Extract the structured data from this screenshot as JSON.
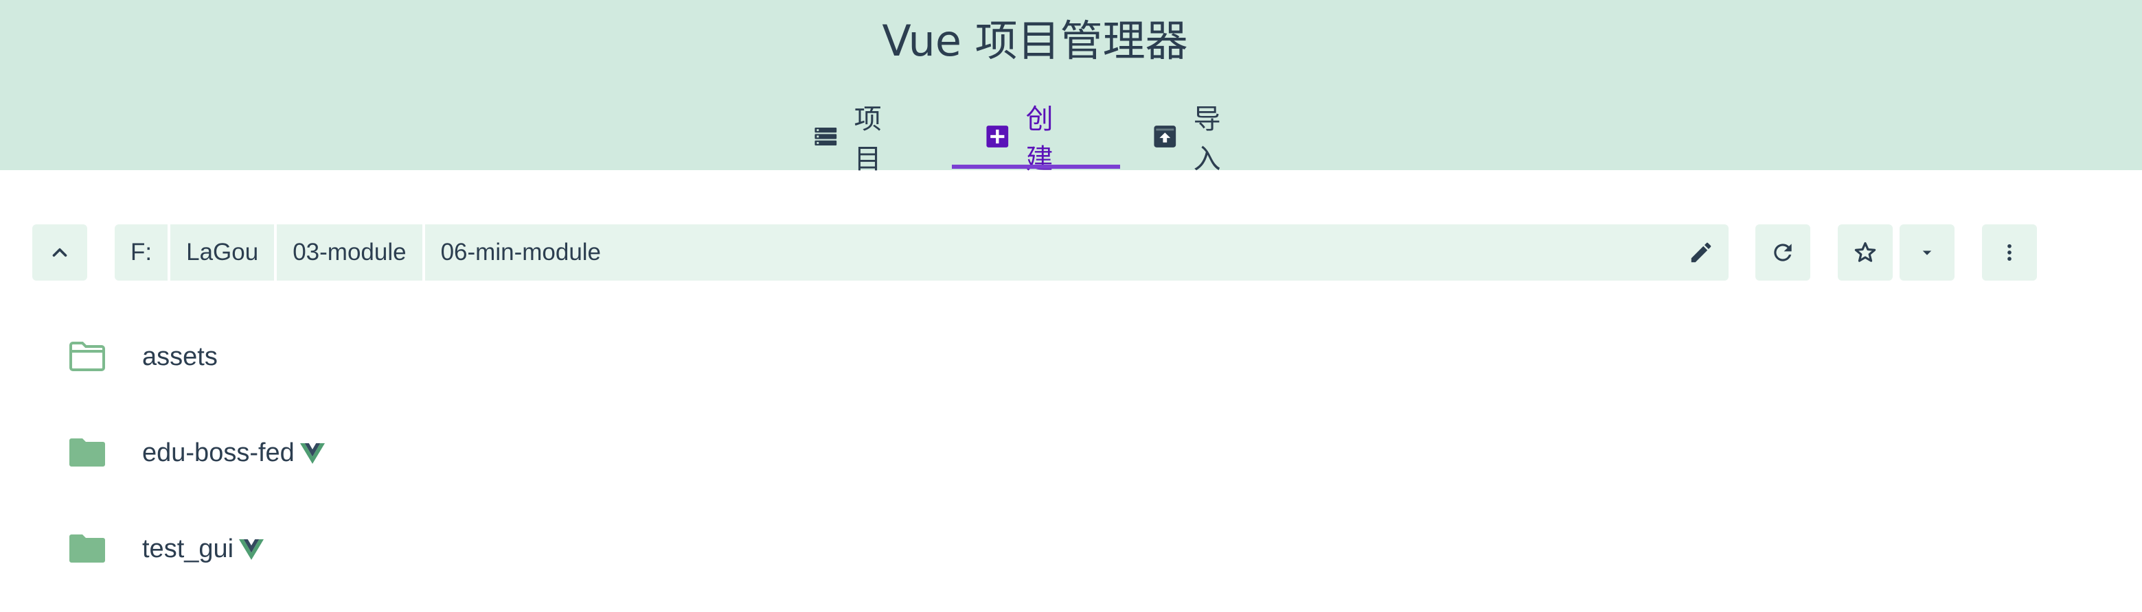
{
  "app": {
    "title": "Vue 项目管理器"
  },
  "tabs": [
    {
      "label": "项目",
      "icon": "list-icon",
      "active": false
    },
    {
      "label": "创建",
      "icon": "plus-box-icon",
      "active": true
    },
    {
      "label": "导入",
      "icon": "archive-upload-icon",
      "active": false
    }
  ],
  "toolbar": {
    "up_icon": "chevron-up-icon",
    "path_segments": [
      "F:",
      "LaGou",
      "03-module",
      "06-min-module"
    ],
    "edit_icon": "pencil-icon",
    "refresh_icon": "refresh-icon",
    "favorite_icon": "star-outline-icon",
    "favorites_dropdown_icon": "caret-down-icon",
    "more_icon": "more-vertical-icon"
  },
  "folders": [
    {
      "name": "assets",
      "icon": "folder-outline-icon",
      "vue_project": false
    },
    {
      "name": "edu-boss-fed",
      "icon": "folder-icon",
      "vue_project": true
    },
    {
      "name": "test_gui",
      "icon": "folder-icon",
      "vue_project": true
    }
  ],
  "colors": {
    "header_bg": "#d1eadf",
    "accent": "#5b12b8",
    "toolbar_bg": "#e6f4ed",
    "folder_green": "#7dba8e",
    "text": "#2c3e50"
  }
}
